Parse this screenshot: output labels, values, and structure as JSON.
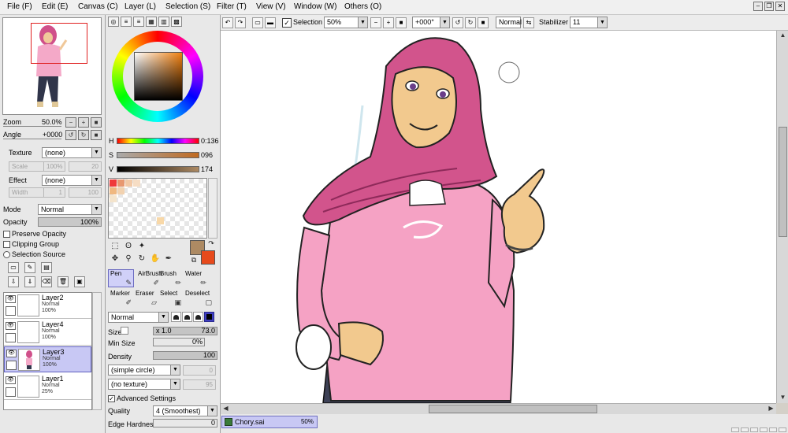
{
  "menu": [
    {
      "label": "File (F)"
    },
    {
      "label": "Edit (E)"
    },
    {
      "label": "Canvas (C)"
    },
    {
      "label": "Layer (L)"
    },
    {
      "label": "Selection (S)"
    },
    {
      "label": "Filter (T)"
    },
    {
      "label": "View (V)"
    },
    {
      "label": "Window (W)"
    },
    {
      "label": "Others (O)"
    }
  ],
  "navigator": {
    "zoom_label": "Zoom",
    "zoom_value": "50.0%",
    "angle_label": "Angle",
    "angle_value": "+0000"
  },
  "texture": {
    "label": "Texture",
    "value": "(none)",
    "scale_label": "Scale",
    "scale_value": "100%",
    "scale_num": "20"
  },
  "effect": {
    "label": "Effect",
    "value": "(none)",
    "width_label": "Width",
    "width_value": "1",
    "width_num": "100"
  },
  "layer_props": {
    "mode_label": "Mode",
    "mode_value": "Normal",
    "opacity_label": "Opacity",
    "opacity_value": "100%",
    "preserve_opacity": "Preserve Opacity",
    "clipping_group": "Clipping Group",
    "selection_source": "Selection Source"
  },
  "layers": [
    {
      "name": "Layer2",
      "mode": "Normal",
      "opacity": "100%",
      "selected": false
    },
    {
      "name": "Layer4",
      "mode": "Normal",
      "opacity": "100%",
      "selected": false
    },
    {
      "name": "Layer3",
      "mode": "Normal",
      "opacity": "100%",
      "selected": true
    },
    {
      "name": "Layer1",
      "mode": "Normal",
      "opacity": "25%",
      "selected": false
    }
  ],
  "color": {
    "h_label": "H",
    "h_value": "0:136",
    "s_label": "S",
    "s_value": "096",
    "v_label": "V",
    "v_value": "174",
    "foreground": "#ad8a63",
    "background": "#e74a1c"
  },
  "swatches": [
    "#f03a3a",
    "#e89870",
    "#f2c9a6",
    "#f6ddc4",
    "#f0b880",
    "#f2d2b0",
    "#f4e4cc",
    "#f8d8a8"
  ],
  "tools": [
    {
      "label": "Pen",
      "icon": "pen-icon",
      "active": true
    },
    {
      "label": "AirBrush",
      "icon": "airbrush-icon",
      "active": false
    },
    {
      "label": "Brush",
      "icon": "brush-icon",
      "active": false
    },
    {
      "label": "Water",
      "icon": "water-icon",
      "active": false
    },
    {
      "label": "Marker",
      "icon": "marker-icon",
      "active": false
    },
    {
      "label": "Eraser",
      "icon": "eraser-icon",
      "active": false
    },
    {
      "label": "Select",
      "icon": "select-icon",
      "active": false
    },
    {
      "label": "Deselect",
      "icon": "deselect-icon",
      "active": false
    }
  ],
  "brush": {
    "blend_mode": "Normal",
    "size_label": "Size",
    "size_mult": "x 1.0",
    "size_value": "73.0",
    "min_size_label": "Min Size",
    "min_size_value": "0%",
    "density_label": "Density",
    "density_value": "100",
    "shape": "(simple circle)",
    "shape_num": "0",
    "texture": "(no texture)",
    "texture_num": "95",
    "advanced_label": "Advanced Settings",
    "quality_label": "Quality",
    "quality_value": "4 (Smoothest)",
    "edge_label": "Edge Hardness",
    "edge_value": "0"
  },
  "toolbar": {
    "selection_label": "Selection",
    "zoom_value": "50%",
    "angle_value": "+000°",
    "blend_value": "Normal",
    "stabilizer_label": "Stabilizer",
    "stabilizer_value": "11"
  },
  "document": {
    "name": "Chory.sai",
    "zoom": "50%"
  }
}
